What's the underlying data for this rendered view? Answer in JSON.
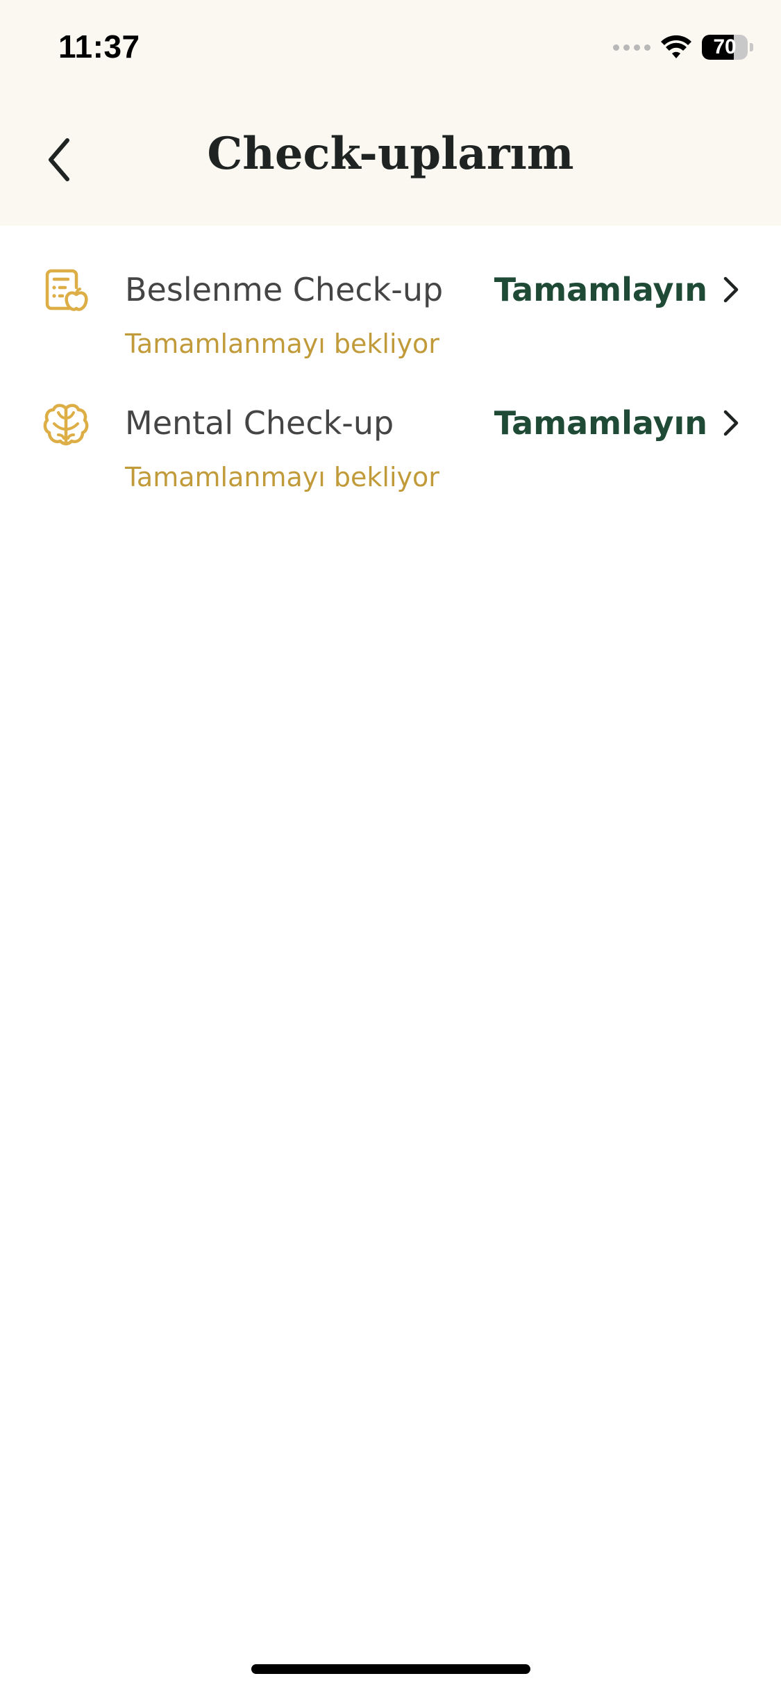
{
  "status_bar": {
    "time": "11:37",
    "battery_level": "70",
    "battery_percent": 70
  },
  "header": {
    "title": "Check-uplarım",
    "back_icon": "chevron-left-icon"
  },
  "checkups": [
    {
      "title": "Beslenme Check-up",
      "status": "Tamamlanmayı bekliyor",
      "action": "Tamamlayın",
      "icon": "nutrition-checklist-icon"
    },
    {
      "title": "Mental Check-up",
      "status": "Tamamlanmayı bekliyor",
      "action": "Tamamlayın",
      "icon": "brain-icon"
    }
  ],
  "colors": {
    "header_bg": "#faf8f1",
    "accent_gold": "#c19a3a",
    "icon_gold": "#dcae45",
    "action_green": "#1f4a36",
    "title_text": "#1f2423"
  }
}
